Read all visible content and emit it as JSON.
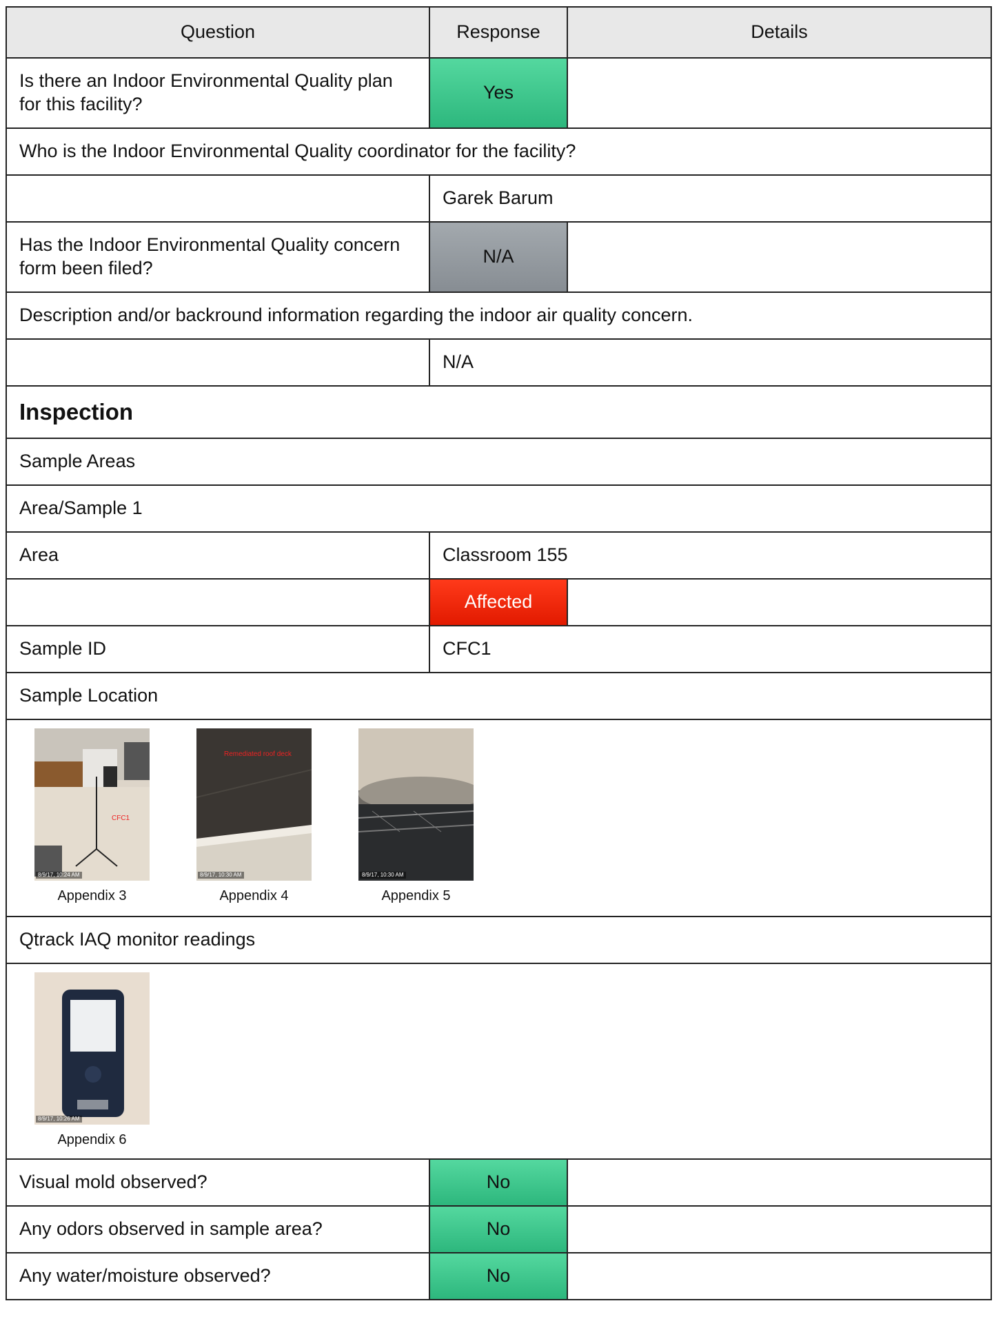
{
  "header": {
    "question": "Question",
    "response": "Response",
    "details": "Details"
  },
  "rows": {
    "iaq_plan": {
      "question": "Is there an Indoor Environmental Quality plan for this facility?",
      "response": "Yes",
      "color": "#3cc88c"
    },
    "coordinator_q": "Who is the Indoor Environmental Quality coordinator for the facility?",
    "coordinator_a": "Garek Barum",
    "concern_form": {
      "question": "Has the Indoor Environmental Quality concern form been filed?",
      "response": "N/A",
      "color": "#969ca1"
    },
    "description_q": "Description and/or backround information regarding the indoor air quality concern.",
    "description_a": "N/A"
  },
  "inspection": {
    "heading": "Inspection",
    "sample_areas": "Sample Areas",
    "area_sample": "Area/Sample 1",
    "area_label": "Area",
    "area_value": "Classroom 155",
    "status": {
      "label": "Affected",
      "color": "#ff2a0a"
    },
    "sample_id_label": "Sample ID",
    "sample_id_value": "CFC1",
    "sample_location": "Sample Location",
    "location_photos": [
      {
        "caption": "Appendix 3",
        "stamp": "8/9/17, 10:24 AM",
        "overlay": "CFC1"
      },
      {
        "caption": "Appendix 4",
        "stamp": "8/9/17, 10:30 AM",
        "overlay": "Remediated roof deck"
      },
      {
        "caption": "Appendix 5",
        "stamp": "8/9/17, 10:30 AM",
        "overlay": ""
      }
    ],
    "monitor_label": "Qtrack IAQ monitor readings",
    "monitor_photo": {
      "caption": "Appendix 6",
      "stamp": "8/9/17, 10:26 AM"
    },
    "checks": [
      {
        "question": "Visual mold observed?",
        "response": "No"
      },
      {
        "question": "Any odors observed in sample area?",
        "response": "No"
      },
      {
        "question": "Any water/moisture observed?",
        "response": "No"
      }
    ]
  }
}
